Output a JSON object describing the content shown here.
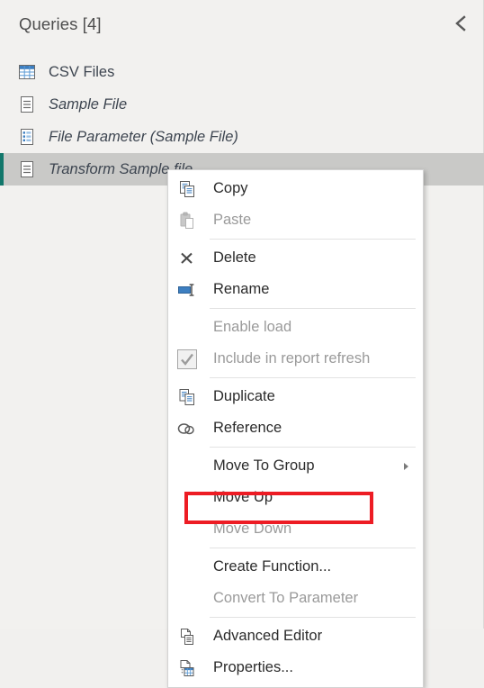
{
  "pane": {
    "title": "Queries [4]",
    "collapse_icon": "chevron-left-icon",
    "accent_color": "#12776b",
    "selected_row_bg": "#c9c9c7",
    "background": "#f2f1ef"
  },
  "queries": [
    {
      "label": "CSV Files",
      "icon": "table-icon",
      "italic": false,
      "selected": false
    },
    {
      "label": "Sample File",
      "icon": "document-lines-icon",
      "italic": true,
      "selected": false
    },
    {
      "label": "File Parameter (Sample File)",
      "icon": "parameter-icon",
      "italic": true,
      "selected": false
    },
    {
      "label": "Transform Sample file",
      "icon": "document-lines-icon",
      "italic": true,
      "selected": true
    }
  ],
  "context_menu": {
    "items": [
      {
        "label": "Copy",
        "icon": "copy-icon",
        "disabled": false,
        "submenu": false,
        "separator_after": false
      },
      {
        "label": "Paste",
        "icon": "paste-icon",
        "disabled": true,
        "submenu": false,
        "separator_after": true
      },
      {
        "label": "Delete",
        "icon": "delete-x-icon",
        "disabled": false,
        "submenu": false,
        "separator_after": false
      },
      {
        "label": "Rename",
        "icon": "rename-icon",
        "disabled": false,
        "submenu": false,
        "separator_after": true
      },
      {
        "label": "Enable load",
        "icon": "none",
        "disabled": true,
        "submenu": false,
        "separator_after": false
      },
      {
        "label": "Include in report refresh",
        "icon": "checkbox-checked-icon",
        "disabled": true,
        "submenu": false,
        "separator_after": true
      },
      {
        "label": "Duplicate",
        "icon": "duplicate-icon",
        "disabled": false,
        "submenu": false,
        "separator_after": false
      },
      {
        "label": "Reference",
        "icon": "reference-link-icon",
        "disabled": false,
        "submenu": false,
        "separator_after": true
      },
      {
        "label": "Move To Group",
        "icon": "none",
        "disabled": false,
        "submenu": true,
        "separator_after": false
      },
      {
        "label": "Move Up",
        "icon": "none",
        "disabled": false,
        "submenu": false,
        "separator_after": false
      },
      {
        "label": "Move Down",
        "icon": "none",
        "disabled": true,
        "submenu": false,
        "separator_after": true
      },
      {
        "label": "Create Function...",
        "icon": "none",
        "disabled": false,
        "submenu": false,
        "separator_after": false,
        "highlighted": true
      },
      {
        "label": "Convert To Parameter",
        "icon": "none",
        "disabled": true,
        "submenu": false,
        "separator_after": true
      },
      {
        "label": "Advanced Editor",
        "icon": "advanced-editor-icon",
        "disabled": false,
        "submenu": false,
        "separator_after": false
      },
      {
        "label": "Properties...",
        "icon": "properties-icon",
        "disabled": false,
        "submenu": false,
        "separator_after": false
      }
    ],
    "highlight_color": "#ed1c24"
  }
}
